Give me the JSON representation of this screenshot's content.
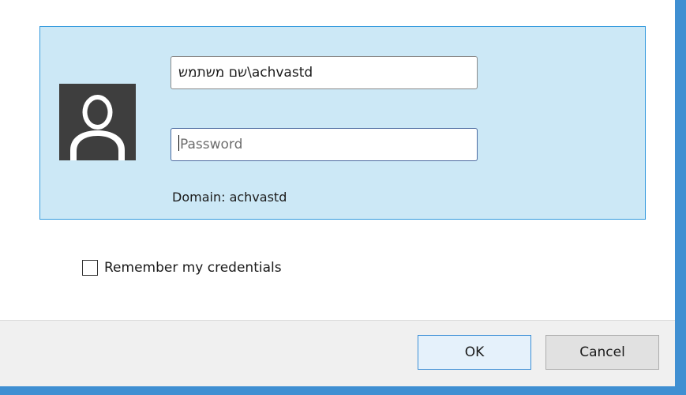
{
  "credentials": {
    "username_value": "שם משתמש\\achvastd",
    "password_placeholder": "Password",
    "domain_label": "Domain: achvastd"
  },
  "options": {
    "remember_label": "Remember my credentials",
    "remember_checked": false
  },
  "buttons": {
    "ok_label": "OK",
    "cancel_label": "Cancel"
  },
  "colors": {
    "tile_background": "#cce8f6",
    "tile_border": "#3399dd",
    "window_accent": "#3f8fd2",
    "avatar_background": "#3e3e3e"
  },
  "icons": {
    "avatar": "user-avatar-icon"
  }
}
